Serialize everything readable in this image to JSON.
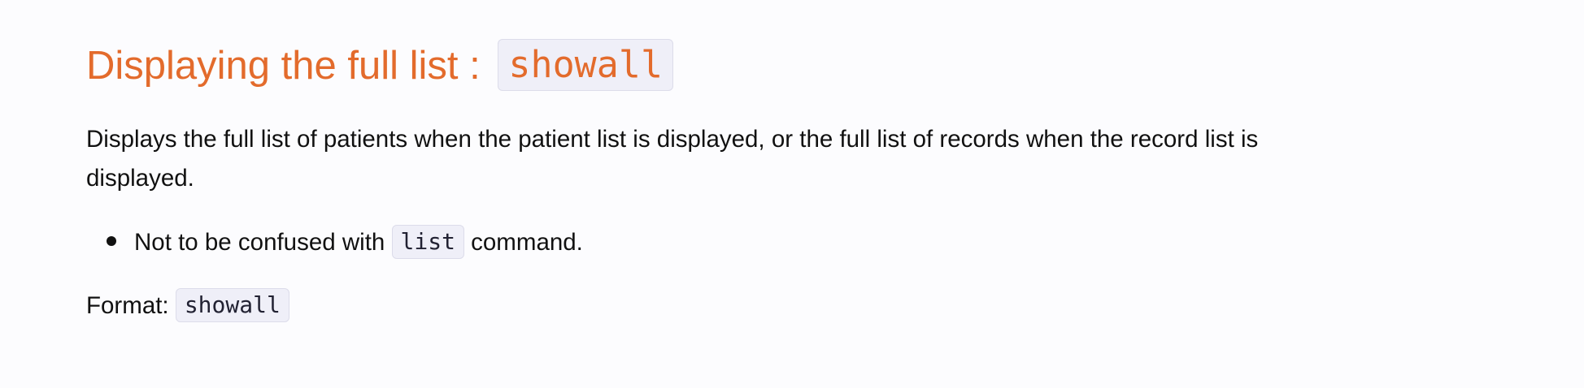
{
  "section": {
    "title_text": "Displaying the full list :",
    "title_code": "showall",
    "description": "Displays the full list of patients when the patient list is displayed, or the full list of records when the record list is displayed.",
    "bullets": [
      {
        "before": "Not to be confused with",
        "code": "list",
        "after": "command."
      }
    ],
    "format_label": "Format:",
    "format_code": "showall"
  },
  "colors": {
    "heading": "#e36b2c",
    "code_background": "#efeff8",
    "page_background": "#fcfcfe"
  }
}
